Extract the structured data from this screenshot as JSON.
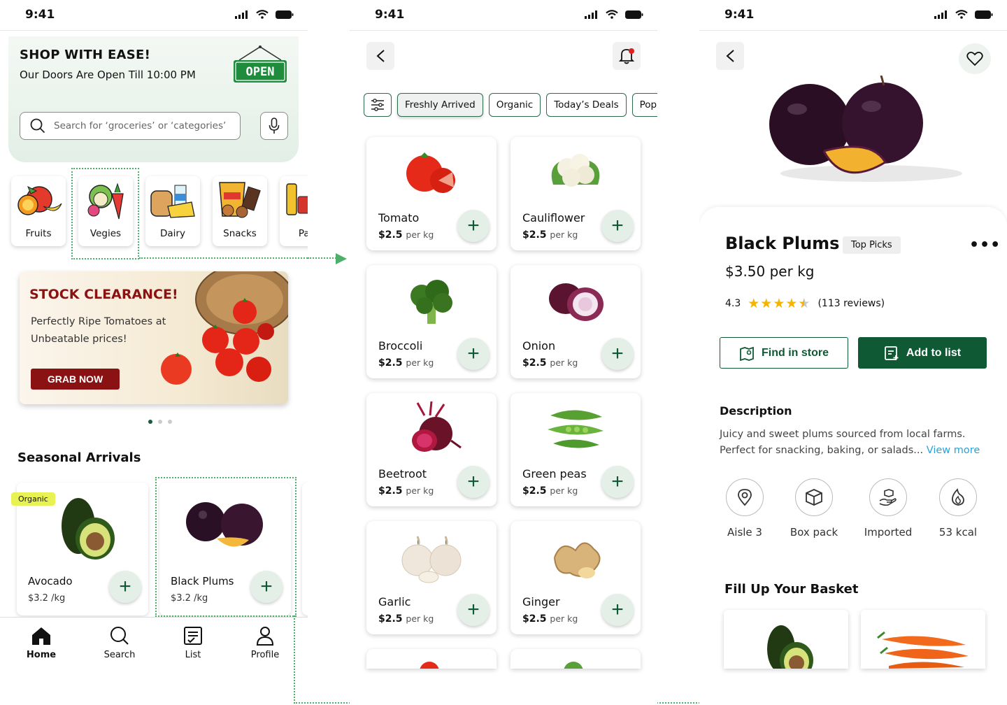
{
  "status": {
    "time": "9:41"
  },
  "home": {
    "hero_title": "SHOP WITH EASE!",
    "hero_subtitle": "Our Doors Are Open Till 10:00 PM",
    "open_sign": "OPEN",
    "search_placeholder": "Search for ‘groceries’ or ‘categories’",
    "categories": [
      {
        "label": "Fruits"
      },
      {
        "label": "Vegies"
      },
      {
        "label": "Dairy"
      },
      {
        "label": "Snacks"
      },
      {
        "label": "Pan"
      }
    ],
    "banner": {
      "title": "STOCK CLEARANCE!",
      "text": "Perfectly Ripe Tomatoes at Unbeatable prices!",
      "button": "GRAB NOW"
    },
    "section_title": "Seasonal Arrivals",
    "products": [
      {
        "tag": "Organic",
        "name": "Avocado",
        "price": "$3.2 /kg"
      },
      {
        "name": "Black Plums",
        "price": "$3.2 /kg"
      }
    ],
    "tabs": [
      {
        "label": "Home"
      },
      {
        "label": "Search"
      },
      {
        "label": "List"
      },
      {
        "label": "Profile"
      }
    ]
  },
  "listing": {
    "filters": [
      "Freshly Arrived",
      "Organic",
      "Today’s Deals",
      "Popu"
    ],
    "unit": "per kg",
    "items": [
      {
        "name": "Tomato",
        "price": "$2.5"
      },
      {
        "name": "Cauliflower",
        "price": "$2.5"
      },
      {
        "name": "Broccoli",
        "price": "$2.5"
      },
      {
        "name": "Onion",
        "price": "$2.5"
      },
      {
        "name": "Beetroot",
        "price": "$2.5"
      },
      {
        "name": "Green peas",
        "price": "$2.5"
      },
      {
        "name": "Garlic",
        "price": "$2.5"
      },
      {
        "name": "Ginger",
        "price": "$2.5"
      }
    ]
  },
  "detail": {
    "title": "Black Plums",
    "tag": "Top Picks",
    "price": "$3.50 per kg",
    "rating": "4.3",
    "stars": 4.5,
    "reviews": "(113 reviews)",
    "find_btn": "Find in store",
    "add_btn": "Add to list",
    "desc_heading": "Description",
    "desc_text": "Juicy and sweet plums sourced from local farms. Perfect for snacking, baking, or salads...",
    "view_more": "View more",
    "features": [
      {
        "label": "Aisle 3",
        "icon": "location-pin-icon"
      },
      {
        "label": "Box pack",
        "icon": "box-icon"
      },
      {
        "label": "Imported",
        "icon": "hand-package-icon"
      },
      {
        "label": "53 kcal",
        "icon": "flame-icon"
      }
    ],
    "basket_heading": "Fill Up Your Basket"
  },
  "colors": {
    "brand_green": "#0f5a35",
    "accent_red": "#8b1212",
    "dotted_link": "#4caf6a",
    "tag_yellow": "#e8f253",
    "link_blue": "#29a3d6"
  }
}
